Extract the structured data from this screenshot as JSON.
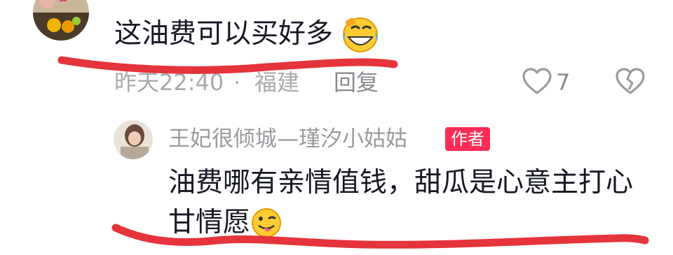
{
  "top_comment": {
    "avatar_icon": "user-avatar",
    "text": "这油费可以买好多",
    "emoji": "laughing-crying-emoji",
    "time": "昨天22:40",
    "separator": "·",
    "location": "福建",
    "reply_label": "回复",
    "like_count": "7",
    "like_icon": "heart-outline-icon",
    "dislike_icon": "broken-heart-icon"
  },
  "reply": {
    "avatar_icon": "user-avatar",
    "name": "王妃很倾城—瑾汐小姑姑",
    "author_badge": "作者",
    "text_line1": "油费哪有亲情值钱，甜瓜是心意主打心",
    "text_line2": "甘情愿",
    "emoji": "tongue-wink-emoji"
  },
  "colors": {
    "accent": "#fe2c55",
    "annotation": "#e5343b",
    "text": "#161823",
    "meta": "#a9aaae"
  }
}
